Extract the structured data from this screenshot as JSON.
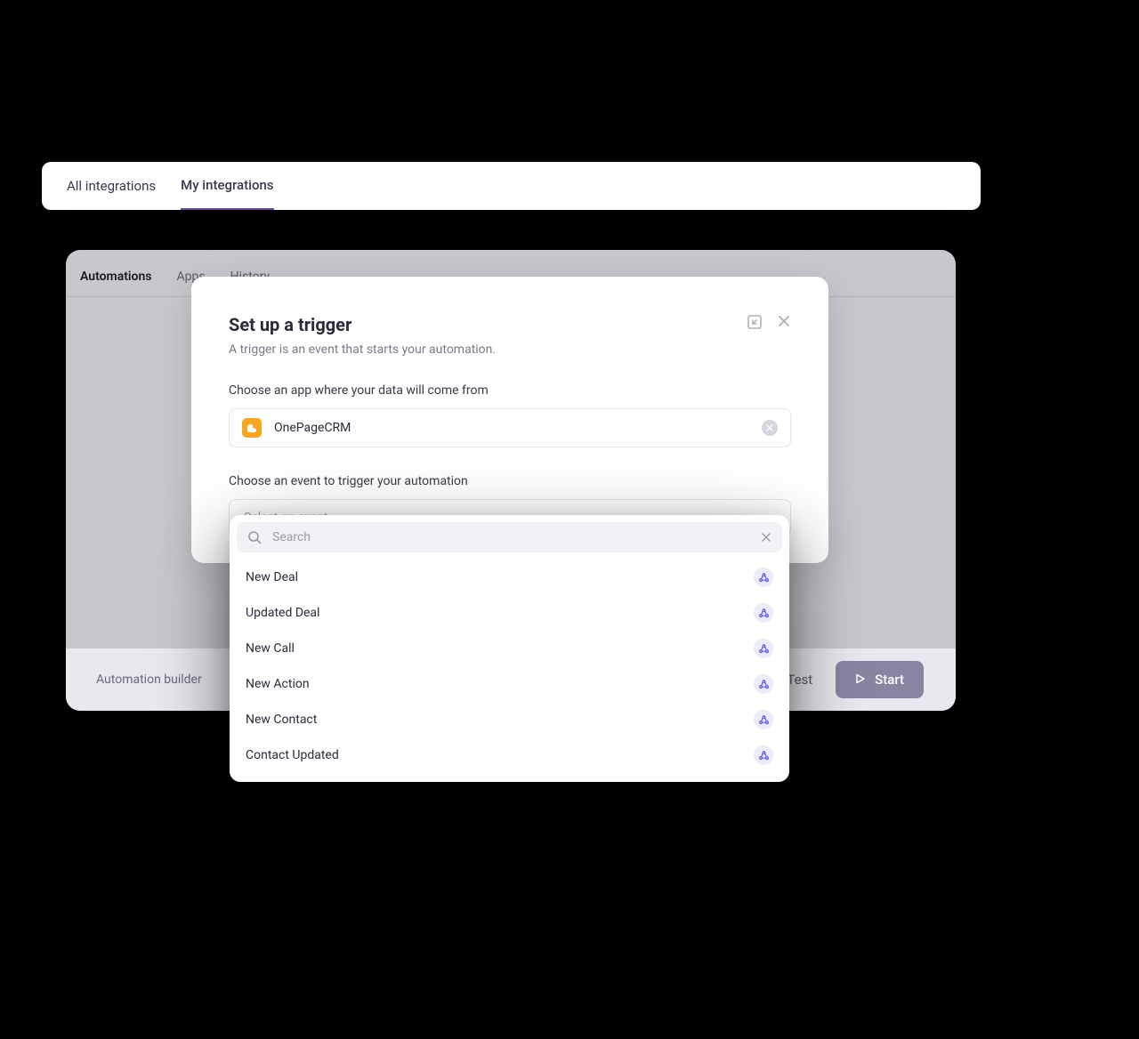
{
  "topTabs": {
    "all": "All integrations",
    "my": "My integrations"
  },
  "mainTabs": {
    "automations": "Automations",
    "apps": "Apps",
    "history": "History"
  },
  "footer": {
    "builder": "Automation builder",
    "test": "Test",
    "start": "Start"
  },
  "modal": {
    "title": "Set up a trigger",
    "subtitle": "A trigger is an event that starts your automation.",
    "chooseAppLabel": "Choose an app where your data will come from",
    "selectedApp": "OnePageCRM",
    "chooseEventLabel": "Choose an event to trigger your automation",
    "eventPlaceholder": "Select an event"
  },
  "dropdown": {
    "searchPlaceholder": "Search",
    "items": [
      "New Deal",
      "Updated Deal",
      "New Call",
      "New Action",
      "New Contact",
      "Contact Updated"
    ]
  }
}
